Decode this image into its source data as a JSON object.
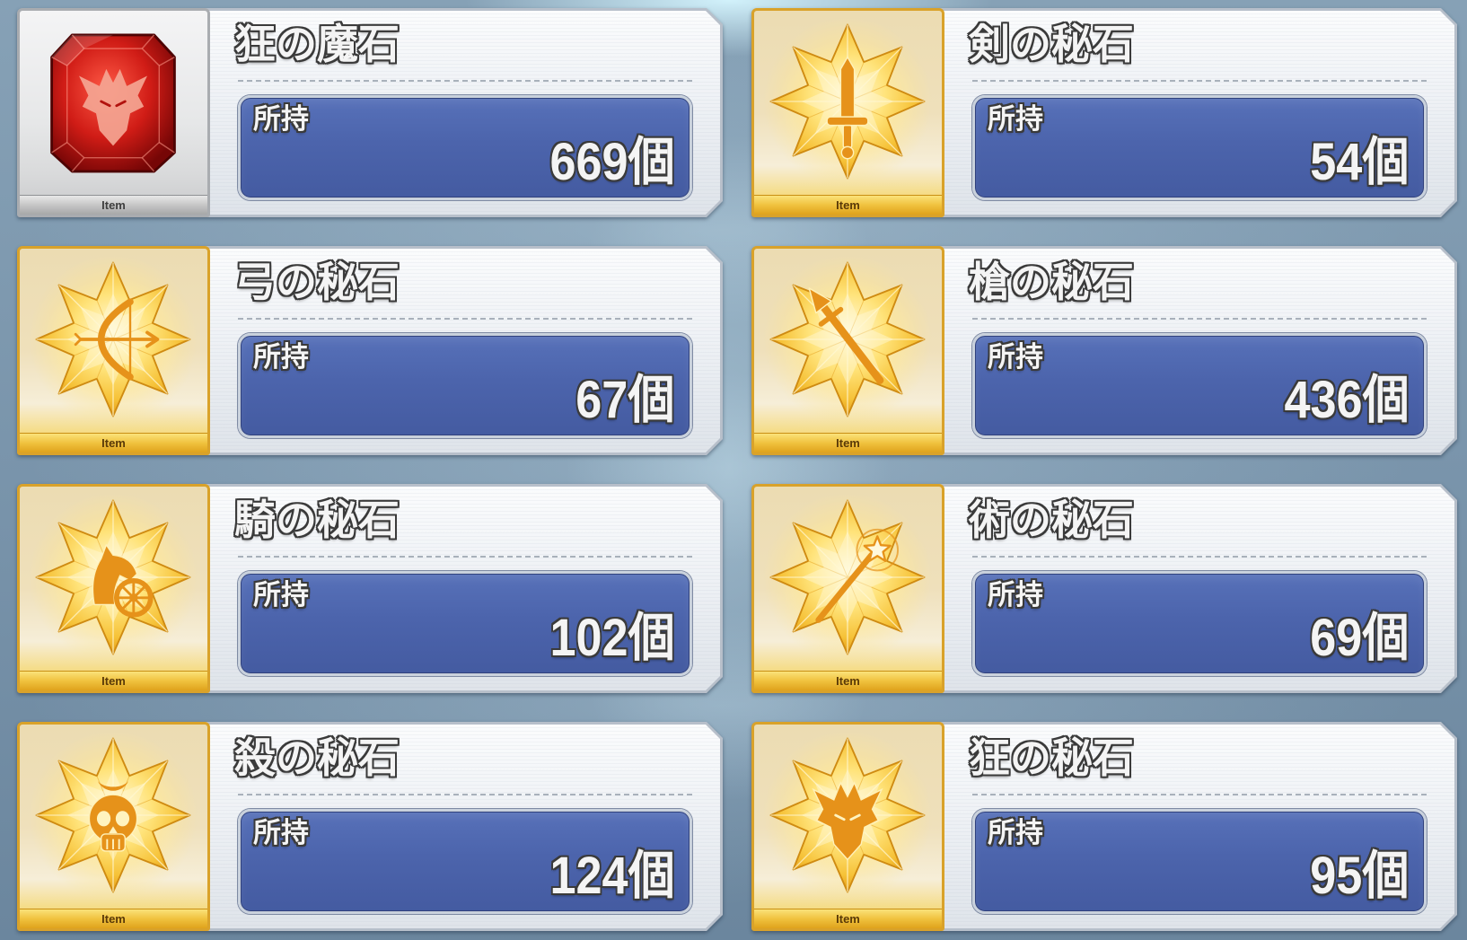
{
  "items": [
    {
      "name": "狂の魔石",
      "held_label": "所持",
      "count": "669個",
      "tag": "Item",
      "icon": "red-gem-beast-icon"
    },
    {
      "name": "剣の秘石",
      "held_label": "所持",
      "count": "54個",
      "tag": "Item",
      "icon": "gold-star-sword-icon"
    },
    {
      "name": "弓の秘石",
      "held_label": "所持",
      "count": "67個",
      "tag": "Item",
      "icon": "gold-star-bow-icon"
    },
    {
      "name": "槍の秘石",
      "held_label": "所持",
      "count": "436個",
      "tag": "Item",
      "icon": "gold-star-lance-icon"
    },
    {
      "name": "騎の秘石",
      "held_label": "所持",
      "count": "102個",
      "tag": "Item",
      "icon": "gold-star-rider-icon"
    },
    {
      "name": "術の秘石",
      "held_label": "所持",
      "count": "69個",
      "tag": "Item",
      "icon": "gold-star-staff-icon"
    },
    {
      "name": "殺の秘石",
      "held_label": "所持",
      "count": "124個",
      "tag": "Item",
      "icon": "gold-star-skull-icon"
    },
    {
      "name": "狂の秘石",
      "held_label": "所持",
      "count": "95個",
      "tag": "Item",
      "icon": "gold-star-beast-icon"
    }
  ],
  "colors": {
    "count_box": "#4c64ac",
    "gold_frame": "#d9a22a",
    "silver_frame": "#a9acb0",
    "gem_red": "#d01c16",
    "symbol_orange": "#e6921a",
    "text_outline": "#3a3a3a"
  }
}
